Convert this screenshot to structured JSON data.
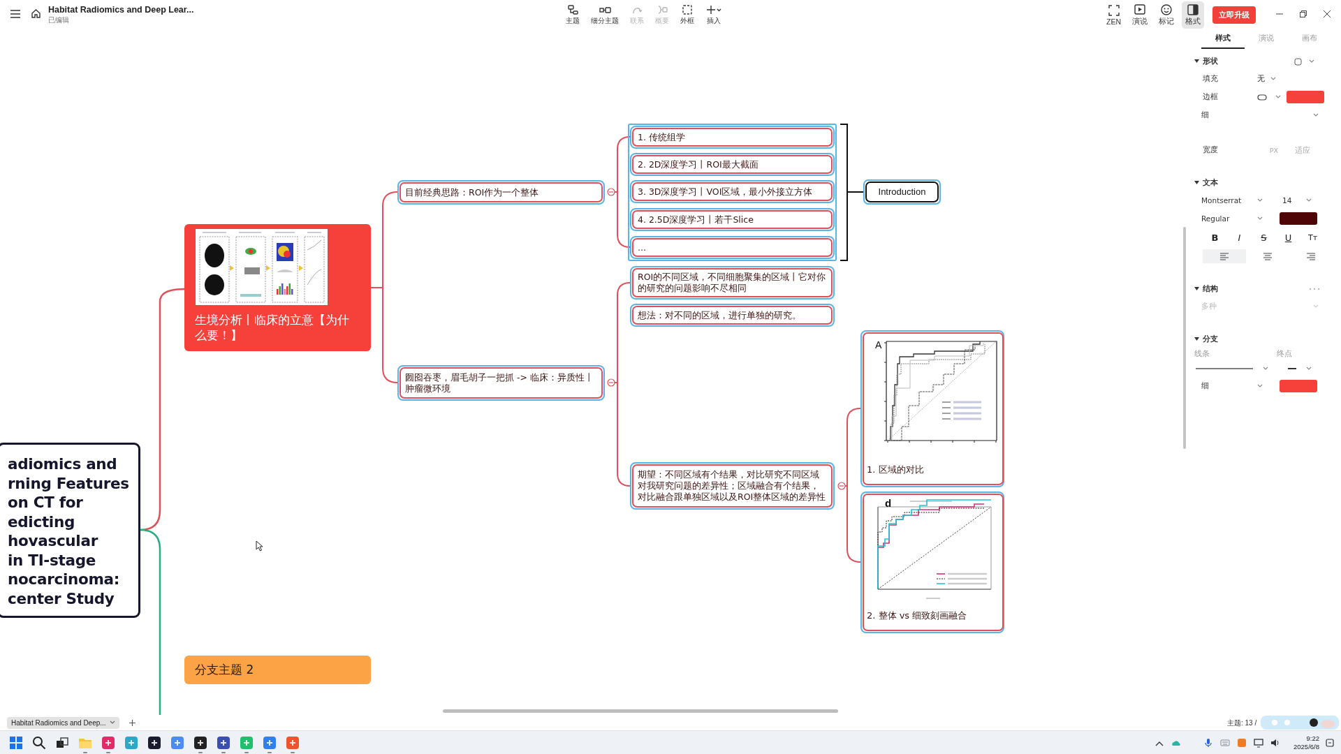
{
  "app_header": {
    "document_title": "Habitat Radiomics and Deep Lear...",
    "save_status": "已编辑"
  },
  "toolbar": [
    {
      "kind": "topic",
      "label": "主题",
      "disabled": false
    },
    {
      "kind": "subtopic",
      "label": "细分主题",
      "disabled": false
    },
    {
      "kind": "relation",
      "label": "联系",
      "disabled": true
    },
    {
      "kind": "summary",
      "label": "概要",
      "disabled": true
    },
    {
      "kind": "boundary",
      "label": "外框",
      "disabled": false
    },
    {
      "kind": "insert",
      "label": "插入",
      "disabled": false
    }
  ],
  "view_tools": [
    {
      "kind": "zen",
      "label": "ZEN",
      "selected": false
    },
    {
      "kind": "pitch",
      "label": "演说",
      "selected": false
    },
    {
      "kind": "marker",
      "label": "标记",
      "selected": false
    },
    {
      "kind": "format",
      "label": "格式",
      "selected": true
    }
  ],
  "upgrade_button": "立即升级",
  "mind_map": {
    "root": {
      "lines": [
        "adiomics and",
        "rning Features",
        "on CT for",
        "edicting",
        "hovascular",
        "in TI-stage",
        "nocarcinoma:",
        "center Study"
      ]
    },
    "branches": [
      {
        "kind": "image_topic",
        "title": "生境分析丨临床的立意【为什么要！】",
        "color": "#f5413a",
        "children": [
          {
            "text": "目前经典思路：ROI作为一个整体",
            "selected": true,
            "expanded": true,
            "children": [
              {
                "text": "1. 传统组学",
                "selected": true
              },
              {
                "text": "2. 2D深度学习丨ROI最大截面",
                "selected": true
              },
              {
                "text": "3. 3D深度学习丨VOI区域，最小外接立方体",
                "selected": true
              },
              {
                "text": "4. 2.5D深度学习丨若干Slice",
                "selected": true
              },
              {
                "text": "...",
                "selected": true
              }
            ]
          },
          {
            "text": "囫囵吞枣，眉毛胡子一把抓 -> 临床：异质性丨肿瘤微环境",
            "selected": true,
            "expanded": true,
            "children": [
              {
                "text": "ROI的不同区域，不同细胞聚集的区域丨它对你的研究的问题影响不尽相同",
                "selected": true
              },
              {
                "text": "想法：对不同的区域，进行单独的研究。",
                "selected": true
              },
              {
                "text": "期望：不同区域有个结果，对比研究不同区域对我研究问题的差异性；区域融合有个结果，对比融合跟单独区域以及ROI整体区域的差异性",
                "selected": true,
                "expanded": true,
                "children": [
                  {
                    "kind": "roc_regions",
                    "panel_label": "A",
                    "caption": "1. 区域的对比",
                    "selected": true
                  },
                  {
                    "kind": "roc_fusion",
                    "panel_label": "d",
                    "caption": "2. 整体 vs 细致刻画融合",
                    "selected": true
                  }
                ]
              }
            ]
          }
        ]
      },
      {
        "kind": "topic",
        "title": "分支主题 2",
        "color": "#fca445"
      }
    ],
    "summary": {
      "text": "Introduction",
      "selected": true
    }
  },
  "format_panel": {
    "tabs": [
      {
        "label": "样式",
        "selected": true
      },
      {
        "label": "演说",
        "selected": false
      },
      {
        "label": "画布",
        "selected": false
      }
    ],
    "sections": [
      {
        "title": "形状",
        "expanded": true,
        "kind": "shape",
        "rows": [
          {
            "kind": "select",
            "label": "填充",
            "value": "无"
          },
          {
            "kind": "border",
            "label": "边框",
            "color": "#f5413a"
          },
          {
            "kind": "dropdown",
            "value": "细",
            "disabled": false
          },
          {
            "kind": "width",
            "label": "宽度",
            "unit": "PX",
            "value": "适应"
          }
        ]
      },
      {
        "title": "文本",
        "expanded": true,
        "rows": [
          {
            "kind": "font",
            "family": "Montserrat",
            "size": "14"
          },
          {
            "kind": "weight",
            "value": "Regular",
            "color": "#4f0505"
          },
          {
            "kind": "styles",
            "buttons": [
              "B",
              "I",
              "S",
              "U",
              "Tт"
            ]
          },
          {
            "kind": "align",
            "options": [
              {
                "kind": "left",
                "selected": true
              },
              {
                "kind": "center",
                "selected": false
              },
              {
                "kind": "right",
                "selected": false
              }
            ]
          }
        ]
      },
      {
        "title": "结构",
        "expanded": true,
        "kind": "more",
        "rows": [
          {
            "kind": "dropdown",
            "value": "多种",
            "disabled": true
          }
        ]
      },
      {
        "title": "分支",
        "expanded": true,
        "rows": [
          {
            "kind": "line",
            "label": "线条",
            "end_label": "终点"
          },
          {
            "kind": "color_select",
            "value": "细",
            "color": "#f5413a"
          }
        ]
      }
    ]
  },
  "sheet_tabs": [
    {
      "label": "Habitat Radiomics and Deep...",
      "selected": true
    }
  ],
  "status": {
    "topic_count": "主题: 13 /"
  },
  "taskbar": {
    "apps": [
      {
        "kind": "start",
        "running": false
      },
      {
        "kind": "search",
        "running": false
      },
      {
        "kind": "taskview",
        "running": false
      },
      {
        "kind": "folder",
        "running": true
      },
      {
        "kind": "tile",
        "color": "#e02d6a",
        "running": true
      },
      {
        "kind": "tile",
        "color": "#2aa7c9",
        "running": false
      },
      {
        "kind": "tile",
        "color": "#1b1b2f",
        "running": false
      },
      {
        "kind": "tile",
        "color": "#4c8bf5",
        "running": false
      },
      {
        "kind": "tile",
        "color": "#222222",
        "running": true
      },
      {
        "kind": "tile",
        "color": "#3a4db0",
        "running": true
      },
      {
        "kind": "tile",
        "color": "#1fbf6b",
        "running": true
      },
      {
        "kind": "tile",
        "color": "#2f80ed",
        "running": true
      },
      {
        "kind": "tile",
        "color": "#f0542d",
        "running": true
      }
    ],
    "time": "9:22",
    "date": "2025/6/8"
  }
}
